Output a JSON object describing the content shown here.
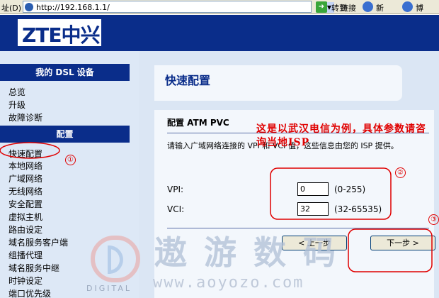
{
  "browser": {
    "address_label": "址(D)",
    "url": "http://192.168.1.1/",
    "dropdown_glyph": "▼",
    "go_icon_glyph": "➜",
    "go_label": "转到",
    "links_label": "链接",
    "link_xinlang": "新浪",
    "link_last": "博"
  },
  "header": {
    "logo_text": "ZTE中兴",
    "brand_color": "#0a2d8a"
  },
  "sidebar": {
    "dsl_head": "我的 DSL 设备",
    "dsl_items": [
      "总览",
      "升级",
      "故障诊断"
    ],
    "config_head": "配置",
    "config_items": [
      "快速配置",
      "本地网络",
      "广域网络",
      "无线网络",
      "安全配置",
      "虚拟主机",
      "路由设定",
      "域名服务客户端",
      "组播代理",
      "域名服务中继",
      "时钟设定",
      "端口优先级"
    ]
  },
  "main": {
    "title": "快速配置",
    "section_label": "配置 ATM PVC",
    "instructions": "请输入广域网络连接的 VPI 和 VCI 值，这些信息由您的 ISP 提供。",
    "vpi_label": "VPI:",
    "vpi_value": "0",
    "vpi_range": "(0-255)",
    "vci_label": "VCI:",
    "vci_value": "32",
    "vci_range": "(32-65535)",
    "prev_button": "< 上一步",
    "next_button": "下一步 >"
  },
  "annotations": {
    "note": "这是以武汉电信为例，具体参数请咨询当地ISP",
    "markers": [
      "①",
      "②",
      "③"
    ],
    "color": "#e00000"
  },
  "watermark": {
    "title": "遨游数码",
    "url": "www.aoyozo.com",
    "digital": "DIGITAL"
  }
}
